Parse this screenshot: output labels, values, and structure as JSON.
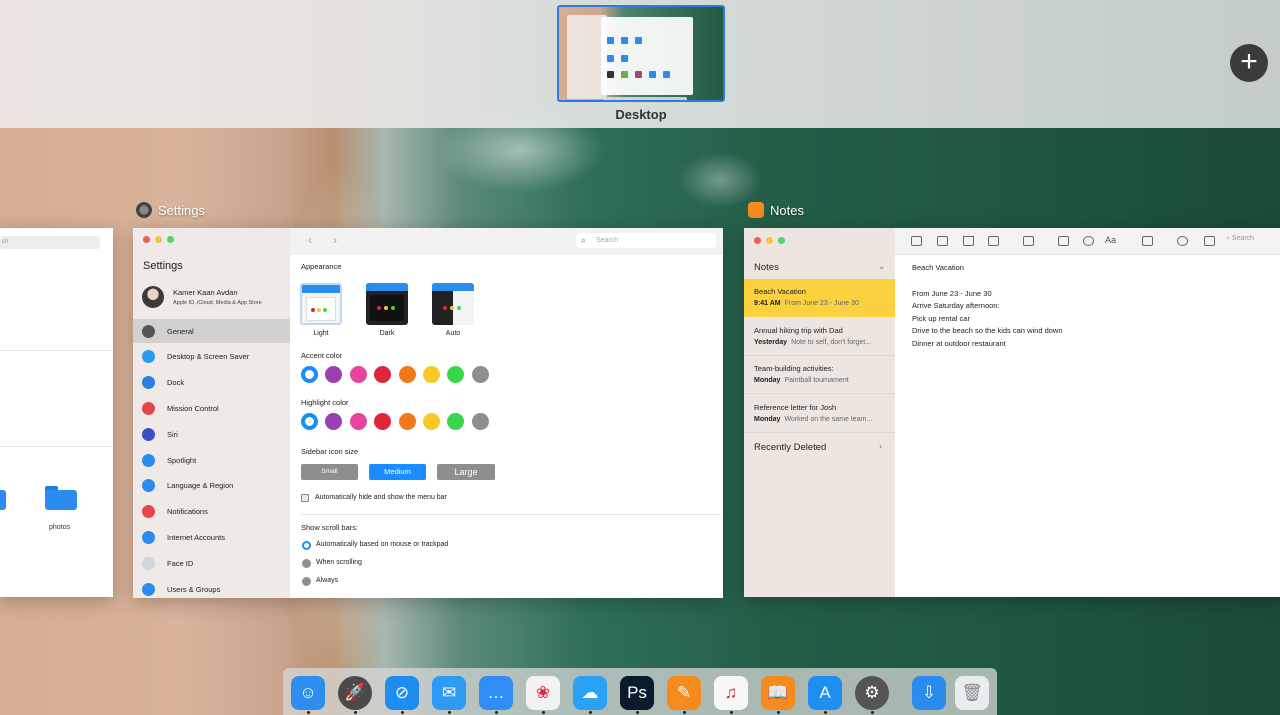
{
  "spaces": {
    "desktop_label": "Desktop",
    "add_label": "+"
  },
  "finder": {
    "search_placeholder": "ch",
    "folder_label": "photos"
  },
  "windows": {
    "settings_title": "Settings",
    "notes_title": "Notes"
  },
  "settings": {
    "sidebar_title": "Settings",
    "profile_name": "Kamer Kaan Avdan",
    "profile_sub": "Apple ID, iCloud, Media & App Store",
    "search_placeholder": "Search",
    "nav_back": "‹",
    "nav_forward": "›",
    "sidebar_items": [
      {
        "label": "General",
        "icon": "gear-icon",
        "color": "#555555"
      },
      {
        "label": "Desktop & Screen Saver",
        "icon": "desktop-icon",
        "color": "#2b9af3"
      },
      {
        "label": "Dock",
        "icon": "dock-icon",
        "color": "#2b7fe0"
      },
      {
        "label": "Mission Control",
        "icon": "mission-control-icon",
        "color": "#e04a4a"
      },
      {
        "label": "Siri",
        "icon": "siri-icon",
        "color": "#3a4fc7"
      },
      {
        "label": "Spotlight",
        "icon": "spotlight-icon",
        "color": "#2b8cf0"
      },
      {
        "label": "Language & Region",
        "icon": "globe-icon",
        "color": "#2b8cf0"
      },
      {
        "label": "Notifications",
        "icon": "notifications-icon",
        "color": "#e5474b"
      },
      {
        "label": "Internet Accounts",
        "icon": "at-icon",
        "color": "#2b8cf0"
      },
      {
        "label": "Face ID",
        "icon": "face-id-icon",
        "color": "#cfd6dd"
      },
      {
        "label": "Users & Groups",
        "icon": "users-icon",
        "color": "#2b8cf0"
      }
    ],
    "appearance_label": "Appearance",
    "appearance_options": [
      "Light",
      "Dark",
      "Auto"
    ],
    "accent_label": "Accent color",
    "highlight_label": "Highlight color",
    "colors": [
      "#1a8cff",
      "#9b3fb5",
      "#e8459a",
      "#e0263a",
      "#f07a1a",
      "#f7c82a",
      "#39d64c",
      "#8e8e8e"
    ],
    "sidebar_icon_size_label": "Sidebar icon size",
    "size_options": [
      "Small",
      "Medium",
      "Large"
    ],
    "menu_bar_checkbox": "Automatically hide and show the menu bar",
    "scroll_bars_label": "Show scroll bars:",
    "scroll_options": [
      "Automatically based on mouse or trackpad",
      "When scrolling",
      "Always"
    ]
  },
  "notes": {
    "list_header": "Notes",
    "items": [
      {
        "title": "Beach Vacation",
        "date": "9:41 AM",
        "preview": "From June 23 - June 30"
      },
      {
        "title": "Annual hiking trip with Dad",
        "date": "Yesterday",
        "preview": "Note to self, don't forget..."
      },
      {
        "title": "Team-building activities:",
        "date": "Monday",
        "preview": "Paintball tournament"
      },
      {
        "title": "Reference letter for Josh",
        "date": "Monday",
        "preview": "Worked on the same team..."
      }
    ],
    "recently_deleted": "Recently Deleted",
    "search_placeholder": "Search",
    "note_title": "Beach Vacation",
    "note_lines": [
      "From June 23 - June 30",
      "Arrive Saturday afternoon:",
      "Pick up rental car",
      "Drive to the beach so the kids can wind down",
      "Dinner at outdoor restaurant"
    ]
  },
  "dock": {
    "apps": [
      {
        "name": "finder-icon",
        "color": "#2e8ef0",
        "glyph": "☺"
      },
      {
        "name": "launchpad-icon",
        "color": "#4a4a4a",
        "glyph": "🚀"
      },
      {
        "name": "safari-icon",
        "color": "#1f8cf0",
        "glyph": "⊘"
      },
      {
        "name": "mail-icon",
        "color": "#2d9af3",
        "glyph": "✉"
      },
      {
        "name": "messages-icon",
        "color": "#2f8df5",
        "glyph": "…"
      },
      {
        "name": "photos-icon",
        "color": "#f2f2f2",
        "glyph": "❀"
      },
      {
        "name": "weather-icon",
        "color": "#2aa2f5",
        "glyph": "☁"
      },
      {
        "name": "photoshop-icon",
        "color": "#0b1b2e",
        "glyph": "Ps"
      },
      {
        "name": "notes-app-icon",
        "color": "#f58a1f",
        "glyph": "✎"
      },
      {
        "name": "music-icon",
        "color": "#f7f7f7",
        "glyph": "♫"
      },
      {
        "name": "books-icon",
        "color": "#f58a1f",
        "glyph": "📖"
      },
      {
        "name": "app-store-icon",
        "color": "#1e8ff0",
        "glyph": "A"
      },
      {
        "name": "system-preferences-icon",
        "color": "#555555",
        "glyph": "⚙"
      },
      {
        "name": "downloads-folder-icon",
        "color": "#2b8cf0",
        "glyph": "⇩"
      },
      {
        "name": "trash-icon",
        "color": "#e9ecef",
        "glyph": "🗑"
      }
    ]
  }
}
